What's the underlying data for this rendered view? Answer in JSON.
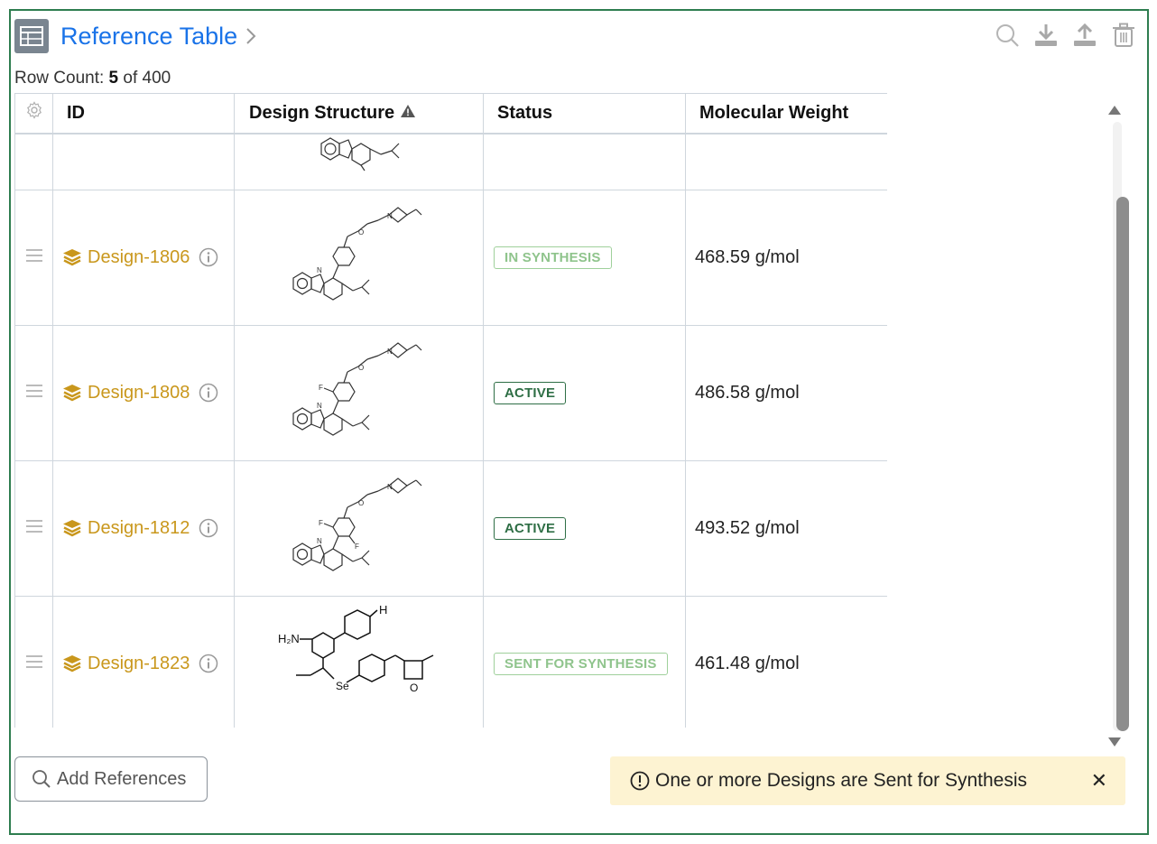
{
  "header": {
    "title": "Reference Table",
    "row_count_prefix": "Row Count: ",
    "row_count_shown": "5",
    "row_count_suffix": " of 400",
    "tools": [
      "search-icon",
      "download-icon",
      "upload-icon",
      "trash-icon"
    ]
  },
  "table": {
    "columns": [
      "ID",
      "Design Structure",
      "Status",
      "Molecular Weight"
    ],
    "rows": [
      {
        "id": "Design-1806",
        "status": "IN SYNTHESIS",
        "mw": "468.59 g/mol"
      },
      {
        "id": "Design-1808",
        "status": "ACTIVE",
        "mw": "486.58 g/mol"
      },
      {
        "id": "Design-1812",
        "status": "ACTIVE",
        "mw": "493.52 g/mol"
      },
      {
        "id": "Design-1823",
        "status": "SENT FOR SYNTHESIS",
        "mw": "461.48 g/mol"
      }
    ],
    "structure_labels": {
      "nh2": "H₂N",
      "se": "Se",
      "h": "H",
      "n": "N",
      "o": "O",
      "f": "F"
    }
  },
  "footer": {
    "add_button": "Add References",
    "notice": "One or more Designs are Sent for Synthesis",
    "close": "✕"
  },
  "colors": {
    "accent": "#1a73e8",
    "design_link": "#c9971c",
    "frame": "#2e7d4f",
    "notice_bg": "#fdf3d2"
  }
}
